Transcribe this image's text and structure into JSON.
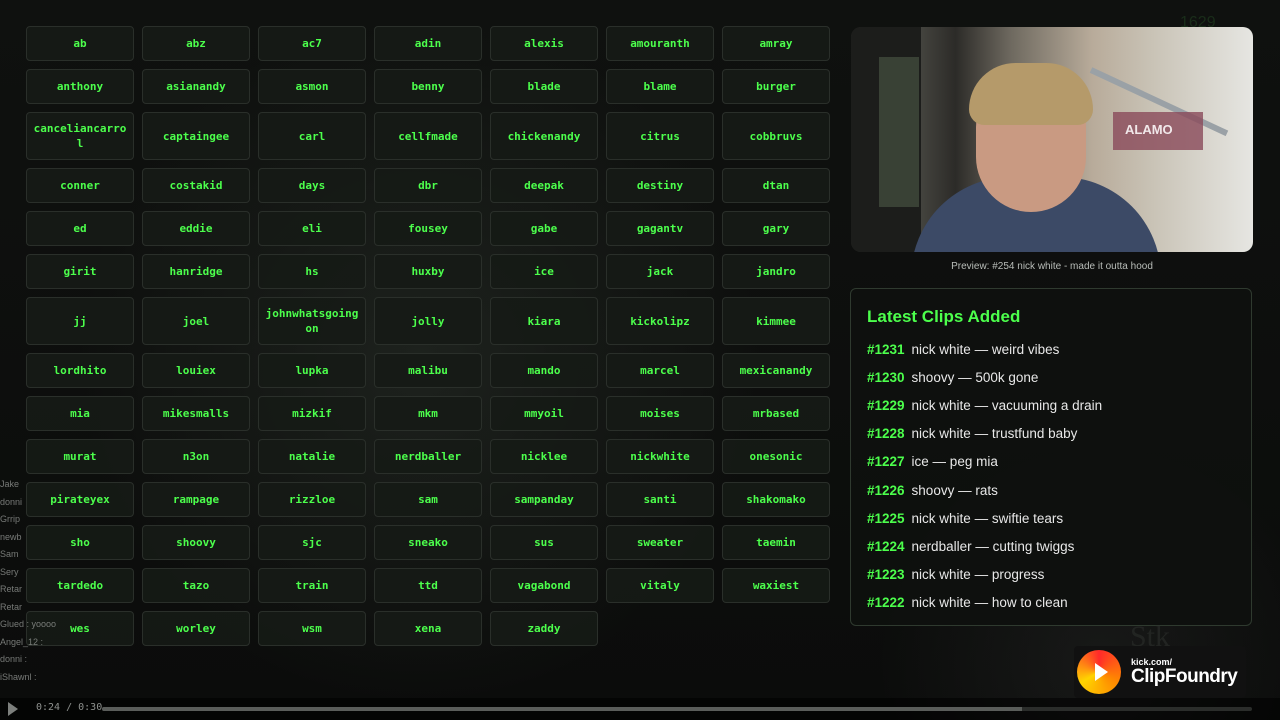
{
  "corner_number": "1629",
  "buttons": [
    "ab",
    "abz",
    "ac7",
    "adin",
    "alexis",
    "amouranth",
    "amray",
    "anthony",
    "asianandy",
    "asmon",
    "benny",
    "blade",
    "blame",
    "burger",
    "canceliancarrol",
    "captaingee",
    "carl",
    "cellfmade",
    "chickenandy",
    "citrus",
    "cobbruvs",
    "conner",
    "costakid",
    "days",
    "dbr",
    "deepak",
    "destiny",
    "dtan",
    "ed",
    "eddie",
    "eli",
    "fousey",
    "gabe",
    "gagantv",
    "gary",
    "girit",
    "hanridge",
    "hs",
    "huxby",
    "ice",
    "jack",
    "jandro",
    "jj",
    "joel",
    "johnwhatsgoingon",
    "jolly",
    "kiara",
    "kickolipz",
    "kimmee",
    "lordhito",
    "louiex",
    "lupka",
    "malibu",
    "mando",
    "marcel",
    "mexicanandy",
    "mia",
    "mikesmalls",
    "mizkif",
    "mkm",
    "mmyoil",
    "moises",
    "mrbased",
    "murat",
    "n3on",
    "natalie",
    "nerdballer",
    "nicklee",
    "nickwhite",
    "onesonic",
    "pirateyex",
    "rampage",
    "rizzloe",
    "sam",
    "sampanday",
    "santi",
    "shakomako",
    "sho",
    "shoovy",
    "sjc",
    "sneako",
    "sus",
    "sweater",
    "taemin",
    "tardedo",
    "tazo",
    "train",
    "ttd",
    "vagabond",
    "vitaly",
    "waxiest",
    "wes",
    "worley",
    "wsm",
    "xena",
    "zaddy"
  ],
  "preview": {
    "sign_text": "ALAMO",
    "caption": "Preview: #254 nick white - made it outta hood"
  },
  "clips": {
    "title": "Latest Clips Added",
    "items": [
      {
        "num": "#1231",
        "text": "nick white — weird vibes"
      },
      {
        "num": "#1230",
        "text": "shoovy — 500k gone"
      },
      {
        "num": "#1229",
        "text": "nick white — vacuuming a drain"
      },
      {
        "num": "#1228",
        "text": "nick white — trustfund baby"
      },
      {
        "num": "#1227",
        "text": "ice — peg mia"
      },
      {
        "num": "#1226",
        "text": "shoovy — rats"
      },
      {
        "num": "#1225",
        "text": "nick white — swiftie tears"
      },
      {
        "num": "#1224",
        "text": "nerdballer — cutting twiggs"
      },
      {
        "num": "#1223",
        "text": "nick white — progress"
      },
      {
        "num": "#1222",
        "text": "nick white — how to clean"
      }
    ]
  },
  "chat": [
    "Jake",
    "donni",
    "Grrip",
    "newb",
    "Sam",
    "Sery",
    "Retar",
    "Retar",
    "Glued : yoooo",
    "Angel_12 :",
    "donni :",
    "iShawnl :"
  ],
  "player": {
    "time": "0:24 / 0:30",
    "progress": 0.8
  },
  "logo": {
    "small": "kick.com/",
    "big": "ClipFoundry"
  },
  "watermark": "Stk"
}
